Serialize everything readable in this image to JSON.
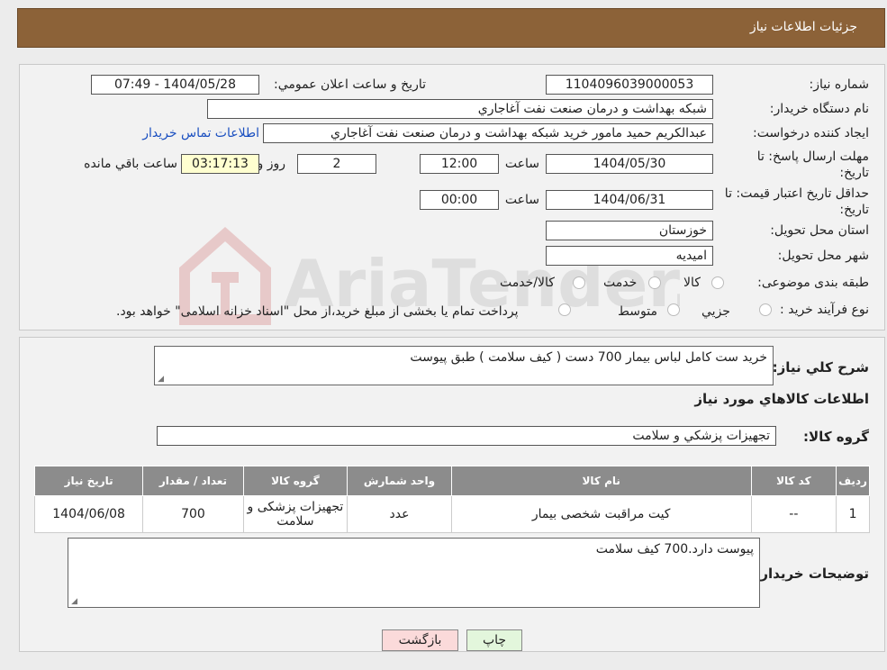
{
  "header": {
    "title": "جزئيات اطلاعات نياز"
  },
  "labels": {
    "need_number": "شماره نياز:",
    "announce_datetime": "تاريخ و ساعت اعلان عمومي:",
    "buyer_org": "نام دستگاه خريدار:",
    "requester": "ايجاد کننده درخواست:",
    "send_deadline": "مهلت ارسال پاسخ: تا تاريخ:",
    "price_validity": "حداقل تاريخ اعتبار قيمت: تا تاريخ:",
    "delivery_province": "استان محل تحويل:",
    "delivery_city": "شهر محل تحويل:",
    "category": "طبقه بندی موضوعی:",
    "process_type": "نوع فرآيند خريد :",
    "time": "ساعت",
    "day_and": "روز و",
    "remaining": "ساعت باقي مانده",
    "description": "شرح کلي نياز:",
    "goods_info": "اطلاعات کالاهاي مورد نياز",
    "goods_group": "گروه کالا:",
    "buyer_notes": "توضيحات خريدار:"
  },
  "fields": {
    "need_number": "1104096039000053",
    "announce_datetime": "1404/05/28 - 07:49",
    "buyer_org": "شبکه بهداشت و درمان صنعت نفت آغاجاري",
    "requester": "عبدالکريم حميد مامور خريد شبکه بهداشت و درمان صنعت نفت آغاجاري",
    "contact_link": "اطلاعات تماس خريدار",
    "send_date": "1404/05/30",
    "send_time": "12:00",
    "days": "2",
    "remaining_time": "03:17:13",
    "validity_date": "1404/06/31",
    "validity_time": "00:00",
    "province": "خوزستان",
    "city": "اميديه",
    "description": "خريد ست کامل لباس بيمار 700 دست ( کيف سلامت ) طبق پيوست",
    "goods_group": "تجهيزات پزشکي و سلامت",
    "buyer_notes": "پيوست دارد.700 کيف سلامت"
  },
  "category_options": [
    "کالا",
    "خدمت",
    "کالا/خدمت"
  ],
  "process_options": [
    "جزيي",
    "متوسط"
  ],
  "process_note": "پرداخت تمام يا بخشی از مبلغ خريد،از محل \"اسناد خزانه اسلامی\" خواهد بود.",
  "table": {
    "headers": [
      "رديف",
      "کد کالا",
      "نام کالا",
      "واحد شمارش",
      "گروه کالا",
      "تعداد / مقدار",
      "تاريخ نياز"
    ],
    "rows": [
      [
        "1",
        "--",
        "کيت مراقبت شخصی بيمار",
        "عدد",
        "تجهيزات پزشکی و سلامت",
        "700",
        "1404/06/08"
      ]
    ]
  },
  "buttons": {
    "print": "چاپ",
    "back": "بازگشت"
  },
  "watermark": {
    "text": "AriaTender.neT"
  },
  "colors": {
    "header_bg": "#8c6238",
    "print_bg": "#e3f6dc",
    "back_bg": "#fbdada",
    "link": "#1a4fc0"
  }
}
